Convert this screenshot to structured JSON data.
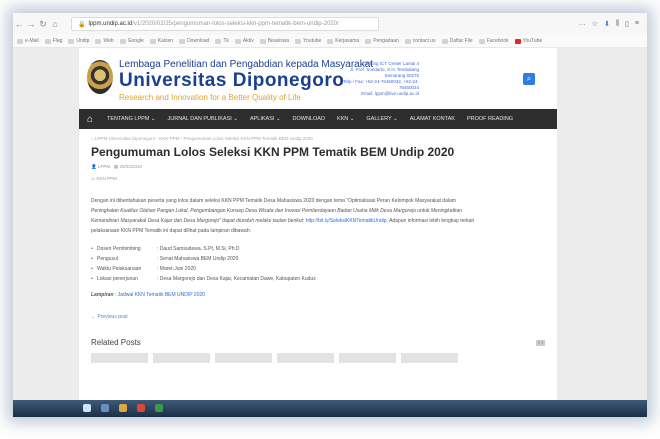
{
  "browser": {
    "url_host": "lppm.undip.ac.id",
    "url_path": "/v1/2020/02/25/pengumuman-lolos-seleksi-kkn-ppm-tematik-bem-undip-2020/",
    "bookmarks": [
      "e-Mail",
      "Flag",
      "Undip",
      "Web",
      "Google",
      "Kaizen",
      "Download",
      "Tk",
      "Aktiv",
      "Beasiswa",
      "Youtube",
      "Kerjasama",
      "Pengadaan",
      "contact us",
      "Daftar File",
      "Facebook",
      "YouTube"
    ]
  },
  "site": {
    "institution_line1": "Lembaga Penelitian dan Pengabdian kepada Masyarakat",
    "institution_name": "Universitas Diponegoro",
    "tagline": "Research and Innovation for a Better Quality of Life",
    "contact_line1": "Gedung ICT Center Lantai 4",
    "contact_line2": "Jl. Prof. Soedarto, S.H. Tembalang Semarang 50275",
    "contact_line3": "Telp / Fax: +62-24-76460032, +62-24-76460034",
    "contact_line4": "Email: lppm@live.undip.ac.id"
  },
  "menu": [
    "TENTANG LPPM ⌄",
    "JURNAL DAN PUBLIKASI ⌄",
    "APLIKASI ⌄",
    "DOWNLOAD",
    "KKN ⌄",
    "GALLERY ⌄",
    "ALAMAT KONTAK",
    "PROOF READING"
  ],
  "article": {
    "breadcrumb": "⌂ LPPM Universitas Diponegoro › KKN PPM › Pengumuman Lolos Seleksi KKN PPM Tematik BEM Undip 2020",
    "title": "Pengumuman Lolos Seleksi KKN PPM Tematik BEM Undip 2020",
    "author": "LPPM",
    "date": "25/02/2020",
    "tag": "KKN PPM",
    "para1": "Dengan ini diberitahukan peserta yang lolos dalam seleksi KKN PPM Tematik Desa Mahasiswa 2020 dengan tema \"Optimalisasi Peran Kelompok Masyarakat dalam",
    "para1_it1": "Peningkatan Kualitas Olahan Pangan Lokal, Pengembangan Konsep Desa Wisata dan Inovasi Pemberdayaan Badan Usaha Milik Desa Margorejo untuk Meningkatkan",
    "para1_it2": "Kemandirian Masyarakat Desa Kajar dan Desa Margorejo\" dapat diunduh melalui tautan berikut:",
    "para1_link": "http://bit.ly/SeleksiKKNTematikUndip",
    "para1_end": ". Adapun informasi lebih lengkap terkait",
    "para1_last": "pelaksanaan KKN PPM Tematik ini dapat dilihat pada lampiran dibawah:",
    "details": [
      {
        "label": "Dosen Pembimbing",
        "value": ": Daud Samsudewa, S.Pt, M.Si, Ph.D"
      },
      {
        "label": "Pengusul",
        "value": ": Senat Mahasiswa BEM Undip 2020"
      },
      {
        "label": "Waktu Pelaksanaan",
        "value": ": Maret-Juni 2020"
      },
      {
        "label": "Lokasi penerjunan",
        "value": ": Desa Margorejo dan Desa Kajar, Kecamatan Dawe, Kabupaten Kudus"
      }
    ],
    "lampiran_label": "Lampiran",
    "lampiran_link": ": Jadwal KKN Tematik BEM UNDIP 2020",
    "prev_post": "← Previous post",
    "related_title": "Related Posts"
  }
}
